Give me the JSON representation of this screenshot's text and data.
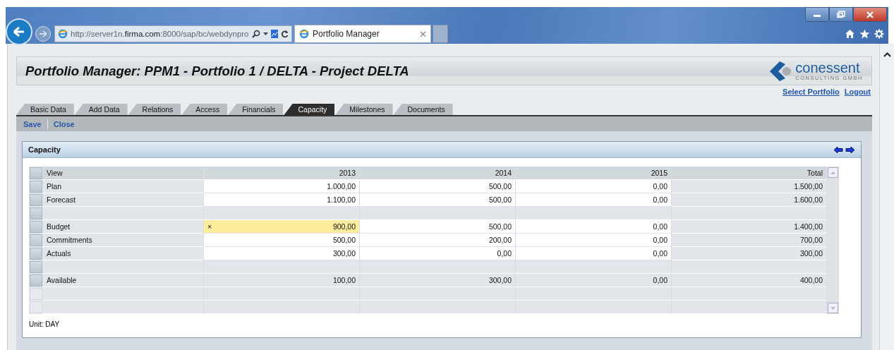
{
  "browser": {
    "address": {
      "prefix": "http://server1n.",
      "host": "firma.com",
      "suffix": ":8000/sap/bc/webdynpro"
    },
    "tabs": [
      {
        "label": "Portfolio Manager",
        "selected": true
      }
    ]
  },
  "header": {
    "title": "Portfolio Manager: PPM1 - Portfolio 1 / DELTA - Project DELTA",
    "logo": {
      "name": "conessent",
      "sub": "CONSULTING GMBH"
    },
    "links": [
      "Select Portfolio",
      "Logout"
    ]
  },
  "tabs": [
    {
      "label": "Basic Data",
      "selected": false
    },
    {
      "label": "Add Data",
      "selected": false
    },
    {
      "label": "Relations",
      "selected": false
    },
    {
      "label": "Access",
      "selected": false
    },
    {
      "label": "Financials",
      "selected": false
    },
    {
      "label": "Capacity",
      "selected": true
    },
    {
      "label": "Milestones",
      "selected": false
    },
    {
      "label": "Documents",
      "selected": false
    }
  ],
  "toolbar": [
    "Save",
    "Close"
  ],
  "panel": {
    "title": "Capacity",
    "table": {
      "columns": [
        "View",
        "2013",
        "2014",
        "2015",
        "Total"
      ],
      "rows": [
        {
          "kind": "data",
          "label": "Plan",
          "cells": [
            {
              "value": "1.000,00",
              "editable": true
            },
            {
              "value": "500,00",
              "editable": true
            },
            {
              "value": "0,00",
              "editable": true
            },
            {
              "value": "1.500,00",
              "editable": false
            }
          ]
        },
        {
          "kind": "data",
          "label": "Forecast",
          "cells": [
            {
              "value": "1.100,00",
              "editable": true
            },
            {
              "value": "500,00",
              "editable": true
            },
            {
              "value": "0,00",
              "editable": true
            },
            {
              "value": "1.600,00",
              "editable": false
            }
          ]
        },
        {
          "kind": "blank"
        },
        {
          "kind": "data",
          "label": "Budget",
          "cells": [
            {
              "value": "900,00",
              "editable": true,
              "selected": true,
              "mark": "×"
            },
            {
              "value": "500,00",
              "editable": true
            },
            {
              "value": "0,00",
              "editable": true
            },
            {
              "value": "1.400,00",
              "editable": false
            }
          ]
        },
        {
          "kind": "data",
          "label": "Commitments",
          "cells": [
            {
              "value": "500,00",
              "editable": true
            },
            {
              "value": "200,00",
              "editable": true
            },
            {
              "value": "0,00",
              "editable": true
            },
            {
              "value": "700,00",
              "editable": false
            }
          ]
        },
        {
          "kind": "data",
          "label": "Actuals",
          "cells": [
            {
              "value": "300,00",
              "editable": true
            },
            {
              "value": "0,00",
              "editable": true
            },
            {
              "value": "0,00",
              "editable": true
            },
            {
              "value": "300,00",
              "editable": false
            }
          ]
        },
        {
          "kind": "blank"
        },
        {
          "kind": "data",
          "label": "Available",
          "cells": [
            {
              "value": "100,00",
              "editable": false
            },
            {
              "value": "300,00",
              "editable": false
            },
            {
              "value": "0,00",
              "editable": false
            },
            {
              "value": "400,00",
              "editable": false
            }
          ]
        },
        {
          "kind": "filler"
        },
        {
          "kind": "filler"
        }
      ]
    },
    "unit": {
      "label": "Unit:",
      "value": "DAY"
    }
  }
}
